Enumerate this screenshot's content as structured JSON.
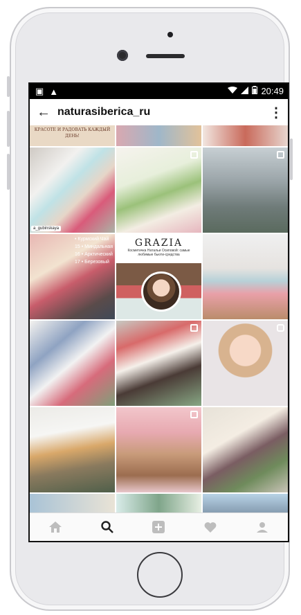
{
  "status": {
    "time": "20:49"
  },
  "header": {
    "username": "naturasiberica_ru"
  },
  "icons": {
    "back": "←",
    "more": "⋮",
    "warning": "▲",
    "image": "▣"
  },
  "tiles": {
    "caption_top": "КРАСОТЕ И РАДОВАТЬ КАЖДЫЙ ДЕНЬ!",
    "user_tag": "a_gubinskaya",
    "list_items": [
      "15 • Миндальная",
      "16 • Арктический",
      "17 • Березовый"
    ],
    "side_label": "• Курмский Чай",
    "grazia_title": "GRAZIA",
    "grazia_subtitle": "Косметичка Натальи Осиповой: самые любимые бьюти-средства"
  },
  "bottom_nav": [
    "home",
    "search",
    "add",
    "activity",
    "profile"
  ],
  "colors": {
    "accent": "#262626",
    "inactive": "#bdbdbd"
  }
}
